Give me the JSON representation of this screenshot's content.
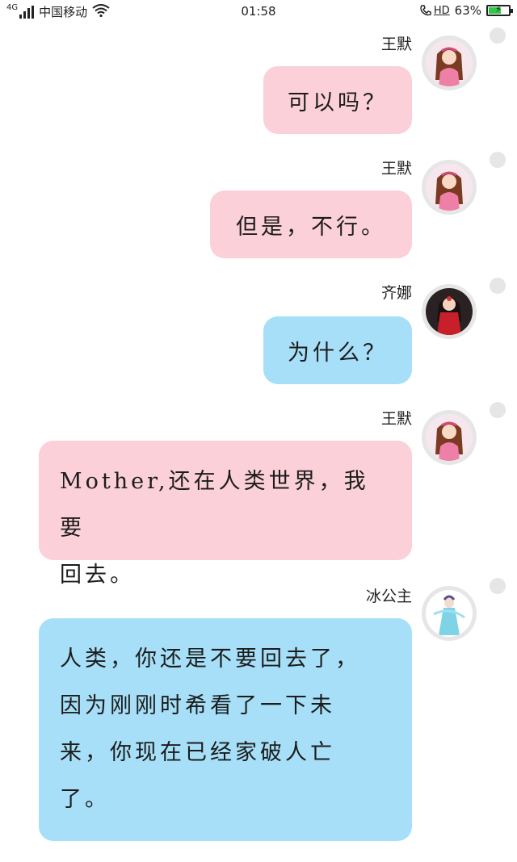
{
  "status_bar": {
    "network_type": "4G",
    "carrier": "中国移动",
    "time": "01:58",
    "hd_label": "HD",
    "battery_percent_text": "63%",
    "battery_level": 0.63,
    "battery_color": "#2fc84a"
  },
  "colors": {
    "pink_bubble": "#fbd0d9",
    "blue_bubble": "#a6dff7",
    "avatar_ring": "#e6e6e6"
  },
  "messages": [
    {
      "sender": "王默",
      "text": "可以吗？",
      "bubble_color": "pink",
      "avatar_icon": "pink-girl-avatar-icon"
    },
    {
      "sender": "王默",
      "text": "但是，不行。",
      "bubble_color": "pink",
      "avatar_icon": "pink-girl-avatar-icon"
    },
    {
      "sender": "齐娜",
      "text": "为什么？",
      "bubble_color": "blue",
      "avatar_icon": "red-dress-girl-avatar-icon"
    },
    {
      "sender": "王默",
      "text": "Mother,还在人类世界，我要回去。",
      "lines": [
        "Mother,还在人类世界，我要",
        "回去。"
      ],
      "bubble_color": "pink",
      "avatar_icon": "pink-girl-avatar-icon"
    },
    {
      "sender": "冰公主",
      "text": "人类，你还是不要回去了，因为刚刚时希看了一下未来，你现在已经家破人亡了。",
      "lines": [
        "人类，你还是不要回去了，",
        "因为刚刚时希看了一下未",
        "来，你现在已经家破人亡",
        "了。"
      ],
      "bubble_color": "blue",
      "avatar_icon": "ice-princess-avatar-icon"
    }
  ]
}
